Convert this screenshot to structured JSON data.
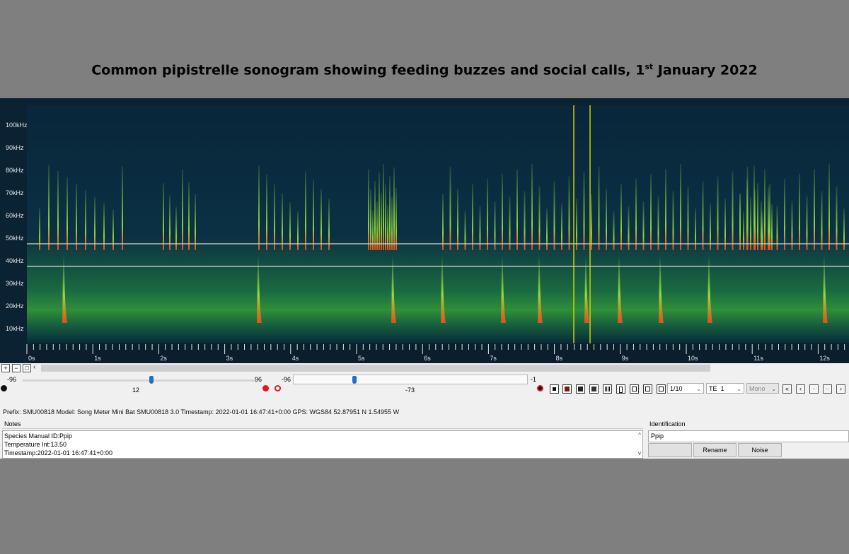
{
  "caption": {
    "text_before": "Common pipistrelle sonogram showing feeding buzzes and social calls, 1",
    "ordinal_suffix": "st",
    "text_after": " January 2022"
  },
  "spectrogram": {
    "freq_ticks": [
      "100kHz",
      "90kHz",
      "80kHz",
      "70kHz",
      "60kHz",
      "50kHz",
      "40kHz",
      "30kHz",
      "20kHz",
      "10kHz"
    ],
    "time_ticks": [
      "0s",
      "1s",
      "2s",
      "3s",
      "4s",
      "5s",
      "6s",
      "7s",
      "8s",
      "9s",
      "10s",
      "11s",
      "12s"
    ],
    "colors": {
      "background": "#0b2a3a",
      "signal": "#8fd13a",
      "hot": "#e04a1a",
      "cursor": "#d8d800",
      "line": "#cfcfcf"
    }
  },
  "controls": {
    "left_slider": {
      "min": "-96",
      "max": "96",
      "value": "12",
      "fraction": 0.56
    },
    "right_slider": {
      "min": "-96",
      "max": "-1",
      "value": "-73",
      "fraction": 0.25
    },
    "ratio_value": "1/10",
    "te_label": "TE",
    "te_value": "1",
    "channel_value": "Mono",
    "left_arrow": "‹"
  },
  "metadata": {
    "line": "Prefix: SMU00818   Model: Song Meter Mini Bat SMU00818 3.0   Timestamp: 2022-01-01 16:47:41+0:00   GPS: WGS84 52.87951 N 1.54955 W"
  },
  "notes": {
    "label": "Notes",
    "lines": [
      "Species Manual ID:Ppip",
      "Temperature Int:13.50",
      "Timestamp:2022-01-01 16:47:41+0:00"
    ]
  },
  "identification": {
    "label": "Identification",
    "value": "Ppip",
    "rename_label": "Rename",
    "noise_label": "Noise"
  }
}
